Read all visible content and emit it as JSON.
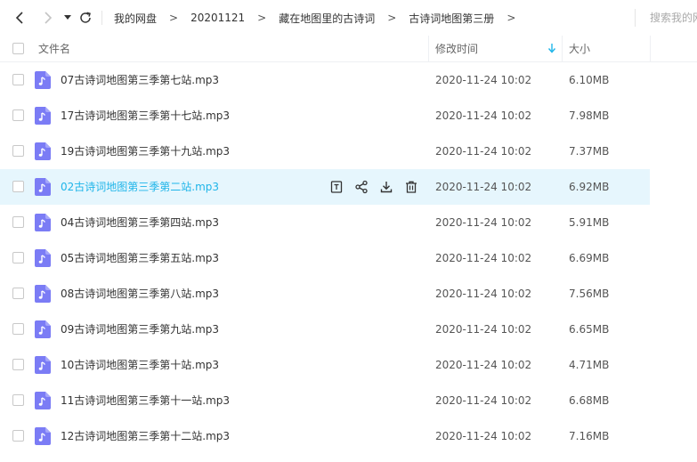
{
  "breadcrumb": [
    "我的网盘",
    "20201121",
    "藏在地图里的古诗词",
    "古诗词地图第三册"
  ],
  "search": {
    "placeholder": "搜索我的网盘文件"
  },
  "columns": {
    "name": "文件名",
    "modified": "修改时间",
    "size": "大小"
  },
  "accent_color": "#1fb5e9",
  "file_icon_color": "#7b7cf5",
  "highlight_row": 3,
  "files": [
    {
      "name": "07古诗词地图第三季第七站.mp3",
      "modified": "2020-11-24 10:02",
      "size": "6.10MB"
    },
    {
      "name": "17古诗词地图第三季第十七站.mp3",
      "modified": "2020-11-24 10:02",
      "size": "7.98MB"
    },
    {
      "name": "19古诗词地图第三季第十九站.mp3",
      "modified": "2020-11-24 10:02",
      "size": "7.37MB"
    },
    {
      "name": "02古诗词地图第三季第二站.mp3",
      "modified": "2020-11-24 10:02",
      "size": "6.92MB"
    },
    {
      "name": "04古诗词地图第三季第四站.mp3",
      "modified": "2020-11-24 10:02",
      "size": "5.91MB"
    },
    {
      "name": "05古诗词地图第三季第五站.mp3",
      "modified": "2020-11-24 10:02",
      "size": "6.69MB"
    },
    {
      "name": "08古诗词地图第三季第八站.mp3",
      "modified": "2020-11-24 10:02",
      "size": "7.56MB"
    },
    {
      "name": "09古诗词地图第三季第九站.mp3",
      "modified": "2020-11-24 10:02",
      "size": "6.65MB"
    },
    {
      "name": "10古诗词地图第三季第十站.mp3",
      "modified": "2020-11-24 10:02",
      "size": "4.71MB"
    },
    {
      "name": "11古诗词地图第三季第十一站.mp3",
      "modified": "2020-11-24 10:02",
      "size": "6.68MB"
    },
    {
      "name": "12古诗词地图第三季第十二站.mp3",
      "modified": "2020-11-24 10:02",
      "size": "7.16MB"
    }
  ],
  "row_actions": [
    "file-info-icon",
    "share-icon",
    "download-icon",
    "delete-icon"
  ]
}
